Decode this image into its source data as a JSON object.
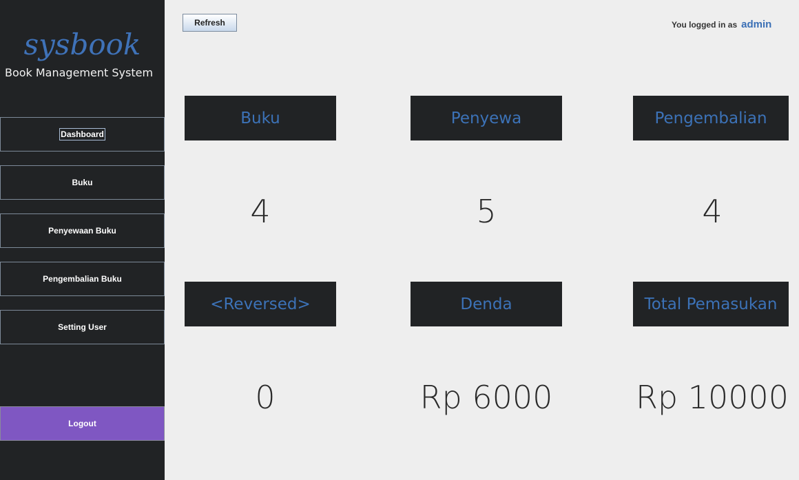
{
  "sidebar": {
    "logo": "sysbook",
    "subtitle": "Book Management System",
    "items": [
      {
        "label": "Dashboard",
        "active": true
      },
      {
        "label": "Buku"
      },
      {
        "label": "Penyewaan Buku"
      },
      {
        "label": "Pengembalian Buku"
      },
      {
        "label": "Setting User"
      }
    ],
    "logout_label": "Logout"
  },
  "header": {
    "refresh_label": "Refresh",
    "login_prefix": "You logged in as",
    "username": "admin"
  },
  "cards": [
    {
      "title": "Buku",
      "value": "4"
    },
    {
      "title": "Penyewa",
      "value": "5"
    },
    {
      "title": "Pengembalian",
      "value": "4"
    },
    {
      "title": "<Reversed>",
      "value": "0"
    },
    {
      "title": "Denda",
      "value": "Rp 6000"
    },
    {
      "title": "Total Pemasukan",
      "value": "Rp 10000"
    }
  ],
  "colors": {
    "sidebar_bg": "#212325",
    "accent_blue": "#3c72b7",
    "logout_purple": "#7f57c2"
  }
}
